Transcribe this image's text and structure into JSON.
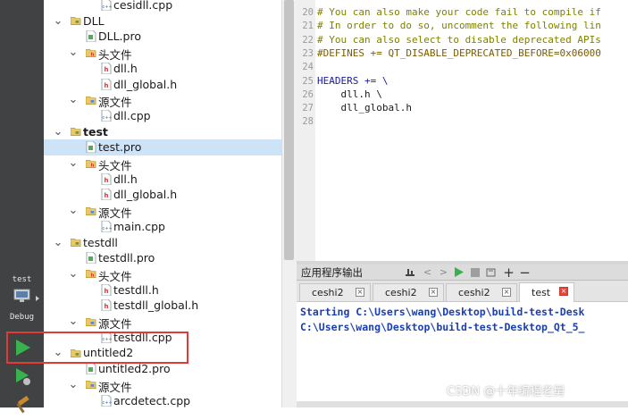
{
  "sidebar": {
    "kit_name": "test",
    "kit_mode": "Debug",
    "highlight_color": "#e53935"
  },
  "tree": {
    "rows": [
      {
        "label": "cesidll.cpp",
        "icon": "cpp-file-icon",
        "bold": false,
        "selected": false,
        "arrow": ""
      },
      {
        "label": "DLL",
        "icon": "project-folder-icon",
        "bold": false,
        "selected": false,
        "arrow": "down"
      },
      {
        "label": "DLL.pro",
        "icon": "pro-file-icon",
        "bold": false,
        "selected": false,
        "arrow": ""
      },
      {
        "label": "头文件",
        "icon": "header-folder-icon",
        "bold": false,
        "selected": false,
        "arrow": "down"
      },
      {
        "label": "dll.h",
        "icon": "header-file-icon",
        "bold": false,
        "selected": false,
        "arrow": ""
      },
      {
        "label": "dll_global.h",
        "icon": "header-file-icon",
        "bold": false,
        "selected": false,
        "arrow": ""
      },
      {
        "label": "源文件",
        "icon": "source-folder-icon",
        "bold": false,
        "selected": false,
        "arrow": "down"
      },
      {
        "label": "dll.cpp",
        "icon": "cpp-file-icon",
        "bold": false,
        "selected": false,
        "arrow": ""
      },
      {
        "label": "test",
        "icon": "project-folder-icon",
        "bold": true,
        "selected": false,
        "arrow": "down"
      },
      {
        "label": "test.pro",
        "icon": "pro-file-icon",
        "bold": false,
        "selected": true,
        "arrow": ""
      },
      {
        "label": "头文件",
        "icon": "header-folder-icon",
        "bold": false,
        "selected": false,
        "arrow": "down"
      },
      {
        "label": "dll.h",
        "icon": "header-file-icon",
        "bold": false,
        "selected": false,
        "arrow": ""
      },
      {
        "label": "dll_global.h",
        "icon": "header-file-icon",
        "bold": false,
        "selected": false,
        "arrow": ""
      },
      {
        "label": "源文件",
        "icon": "source-folder-icon",
        "bold": false,
        "selected": false,
        "arrow": "down"
      },
      {
        "label": "main.cpp",
        "icon": "cpp-file-icon",
        "bold": false,
        "selected": false,
        "arrow": ""
      },
      {
        "label": "testdll",
        "icon": "project-folder-icon",
        "bold": false,
        "selected": false,
        "arrow": "down"
      },
      {
        "label": "testdll.pro",
        "icon": "pro-file-icon",
        "bold": false,
        "selected": false,
        "arrow": ""
      },
      {
        "label": "头文件",
        "icon": "header-folder-icon",
        "bold": false,
        "selected": false,
        "arrow": "down"
      },
      {
        "label": "testdll.h",
        "icon": "header-file-icon",
        "bold": false,
        "selected": false,
        "arrow": ""
      },
      {
        "label": "testdll_global.h",
        "icon": "header-file-icon",
        "bold": false,
        "selected": false,
        "arrow": ""
      },
      {
        "label": "源文件",
        "icon": "source-folder-icon",
        "bold": false,
        "selected": false,
        "arrow": "down"
      },
      {
        "label": "testdll.cpp",
        "icon": "cpp-file-icon",
        "bold": false,
        "selected": false,
        "arrow": ""
      },
      {
        "label": "untitled2",
        "icon": "project-folder-icon",
        "bold": false,
        "selected": false,
        "arrow": "down"
      },
      {
        "label": "untitled2.pro",
        "icon": "pro-file-icon",
        "bold": false,
        "selected": false,
        "arrow": ""
      },
      {
        "label": "源文件",
        "icon": "source-folder-icon",
        "bold": false,
        "selected": false,
        "arrow": "down"
      },
      {
        "label": "arcdetect.cpp",
        "icon": "cpp-file-icon",
        "bold": false,
        "selected": false,
        "arrow": ""
      }
    ]
  },
  "editor": {
    "lines": [
      {
        "num": "20",
        "text": "# You can also make your code fail to compile if",
        "kind": "comment"
      },
      {
        "num": "21",
        "text": "# In order to do so, uncomment the following lin",
        "kind": "comment"
      },
      {
        "num": "22",
        "text": "# You can also select to disable deprecated APIs",
        "kind": "comment"
      },
      {
        "num": "23",
        "text": "#DEFINES += QT_DISABLE_DEPRECATED_BEFORE=0x06000",
        "kind": "define"
      },
      {
        "num": "24",
        "text": "",
        "kind": "plain"
      },
      {
        "num": "25",
        "text": "HEADERS += \\",
        "kind": "kw"
      },
      {
        "num": "26",
        "text": "    dll.h \\",
        "kind": "plain"
      },
      {
        "num": "27",
        "text": "    dll_global.h",
        "kind": "plain"
      },
      {
        "num": "28",
        "text": "",
        "kind": "plain"
      }
    ]
  },
  "output_panel": {
    "title": "应用程序输出",
    "tabs": [
      {
        "label": "ceshi2",
        "active": false
      },
      {
        "label": "ceshi2",
        "active": false
      },
      {
        "label": "ceshi2",
        "active": false
      },
      {
        "label": "test",
        "active": true
      }
    ],
    "lines": [
      "Starting C:\\Users\\wang\\Desktop\\build-test-Desk",
      "C:\\Users\\wang\\Desktop\\build-test-Desktop_Qt_5_"
    ]
  },
  "watermark": "CSDN @十年编程老舅"
}
